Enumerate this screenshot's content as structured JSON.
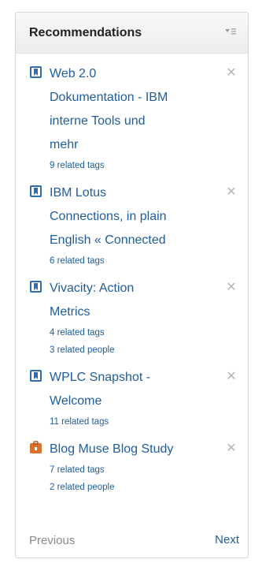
{
  "widget": {
    "title": "Recommendations",
    "menu_icon": "menu-chevron-icon"
  },
  "items": [
    {
      "icon": "bookmark-icon",
      "title_lines": [
        "Web 2.0",
        "Dokumentation - IBM",
        "interne Tools und",
        "mehr"
      ],
      "meta": [
        "9 related tags"
      ]
    },
    {
      "icon": "bookmark-icon",
      "title_lines": [
        "IBM Lotus",
        "Connections, in plain",
        "English « Connected"
      ],
      "meta": [
        "6 related tags"
      ]
    },
    {
      "icon": "bookmark-icon",
      "title_lines": [
        "Vivacity: Action",
        "Metrics"
      ],
      "meta": [
        "4 related tags",
        "3 related people"
      ]
    },
    {
      "icon": "bookmark-icon",
      "title_lines": [
        "WPLC Snapshot -",
        "Welcome"
      ],
      "meta": [
        "11 related tags"
      ]
    },
    {
      "icon": "briefcase-icon",
      "title_lines": [
        "Blog Muse Blog Study"
      ],
      "meta": [
        "7 related tags",
        "2 related people"
      ]
    }
  ],
  "footer": {
    "previous": "Previous",
    "next": "Next"
  },
  "colors": {
    "link": "#1f5d9c",
    "muted": "#888888",
    "bookmark": "#2f6db3",
    "briefcase": "#d9712a"
  }
}
